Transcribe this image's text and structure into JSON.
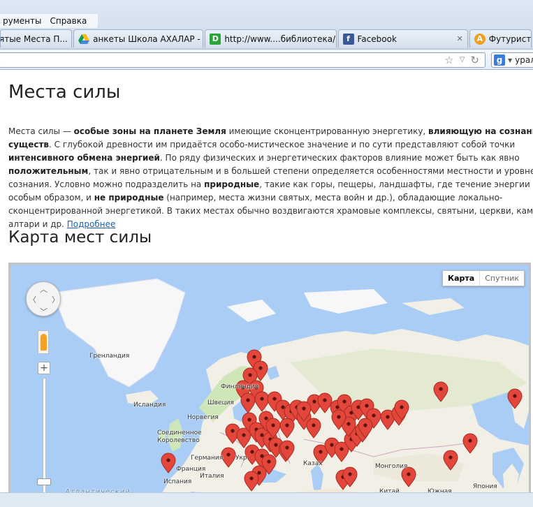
{
  "browser": {
    "menu": [
      "рументы",
      "Справка"
    ],
    "tabs": [
      {
        "label": "ятые Места П...",
        "icon": "generic-page-icon",
        "active": false
      },
      {
        "label": "анкеты Школа АХАЛАР - ...",
        "icon": "google-drive-icon",
        "active": false
      },
      {
        "label": "http://www....библиотека/",
        "icon": "d-site-icon",
        "active": false
      },
      {
        "label": "Facebook",
        "icon": "facebook-icon",
        "active": false
      },
      {
        "label": "Футуристи",
        "icon": "a-site-icon",
        "active": false
      }
    ],
    "search_text": "урал"
  },
  "page": {
    "title": "Места силы",
    "paragraph": [
      {
        "t": "Места силы — ",
        "b": false
      },
      {
        "t": "особые зоны на планете Земля",
        "b": true
      },
      {
        "t": " имеющие сконцентрированную энергетику, ",
        "b": false
      },
      {
        "t": "влияющую на сознание живых существ",
        "b": true
      },
      {
        "t": ". С глубокой древности им придаётся особо-мистическое значение и по сути представляют собой точки ",
        "b": false
      },
      {
        "t": "интенсивного обмена энергией",
        "b": true
      },
      {
        "t": ". По ряду физических и энергетических факторов влияние может быть как явно ",
        "b": false
      },
      {
        "t": "положительным",
        "b": true
      },
      {
        "t": ", так и явно отрицательным",
        "b": false
      },
      {
        "t": " и в большей степени определяется особенностями местности и уровнем сознания. Условно можно подразделить на ",
        "b": false
      },
      {
        "t": "природные",
        "b": true
      },
      {
        "t": ", такие как горы, пещеры, ландшафты, где течение энергии идёт особым образом, и ",
        "b": false
      },
      {
        "t": "не природные",
        "b": true
      },
      {
        "t": " (например, места жизни святых, места войн и др.), обладающие локально-сконцентрированной энергетикой. В таких местах обычно воздвигаются храмовые комплексы, святыни, церкви, каменные алтари и др. ",
        "b": false
      }
    ],
    "more_link": "Подробнее",
    "map_heading": "Карта мест силы"
  },
  "map": {
    "type_buttons": {
      "map": "Карта",
      "satellite": "Спутник",
      "selected": "map"
    },
    "labels": {
      "greenland": "Гренландия",
      "finland": "Финляндия",
      "sweden": "Швеция",
      "iceland": "Исландия",
      "norway": "Норвегия",
      "uk": "Соединенное Королевство",
      "germany": "Германия",
      "ukraine": "Укр",
      "france": "Франция",
      "spain": "Испания",
      "italy": "Италия",
      "kazakhstan": "Казах",
      "mongolia": "Монголия",
      "china": "Китай",
      "japan": "Япония",
      "south": "Южная",
      "atlantic": "Атлантический"
    },
    "colors": {
      "water": "#a9cdf5",
      "land": "#f2efe6",
      "green": "#cfe6b8",
      "ice": "#f7f7f7",
      "marker": "#e3473b"
    }
  }
}
